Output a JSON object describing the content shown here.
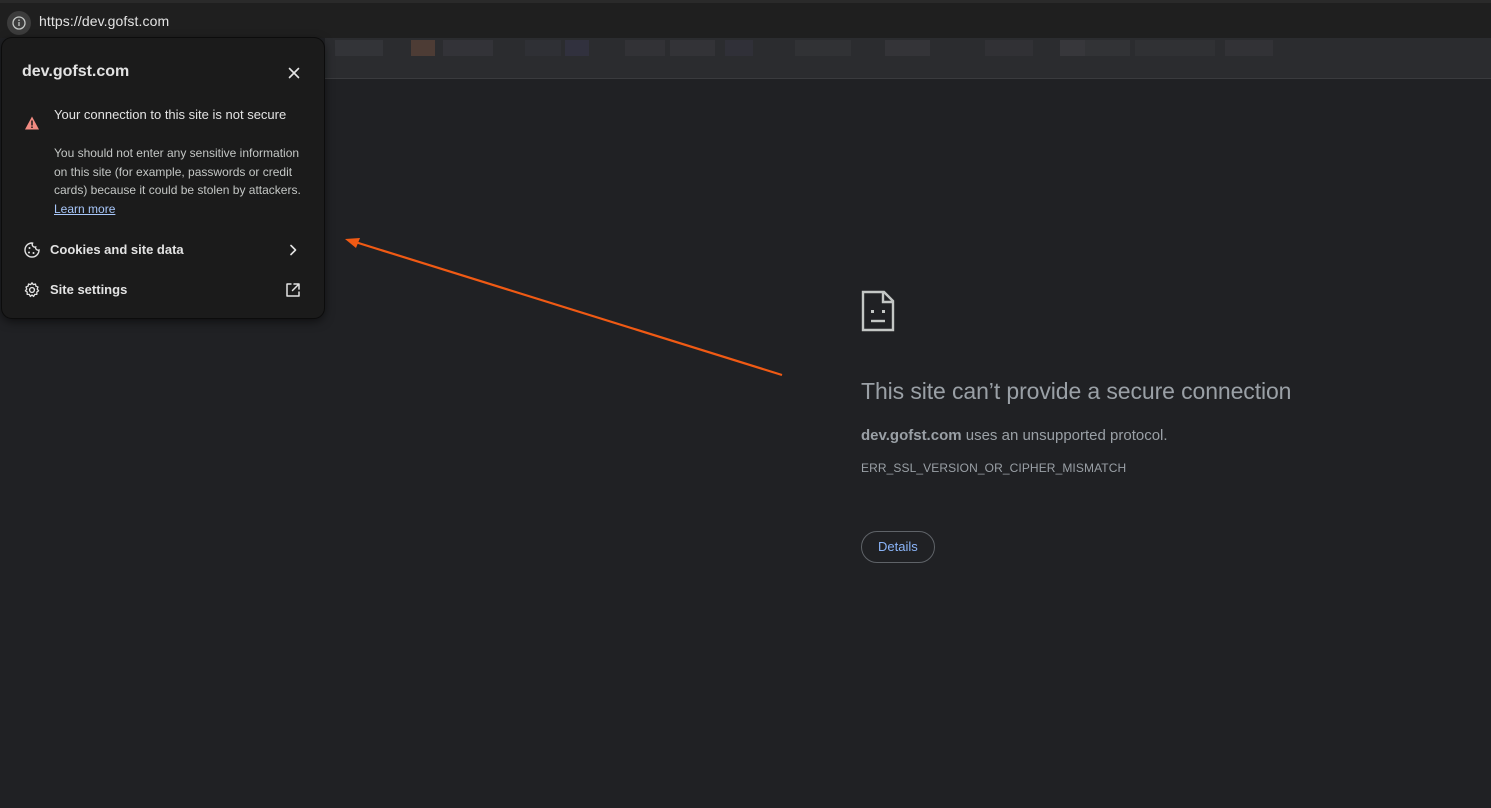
{
  "omnibox": {
    "url": "https://dev.gofst.com",
    "site_info_icon": "info-icon"
  },
  "popup": {
    "title": "dev.gofst.com",
    "close_icon": "close-icon",
    "security": {
      "icon": "warning-triangle-icon",
      "heading": "Your connection to this site is not secure",
      "body": "You should not enter any sensitive information on this site (for example, passwords or credit cards) because it could be stolen by attackers.",
      "learn_more": "Learn more"
    },
    "rows": [
      {
        "label": "Cookies and site data",
        "icon": "cookie-icon",
        "trail_icon": "chevron-right-icon"
      },
      {
        "label": "Site settings",
        "icon": "gear-icon",
        "trail_icon": "external-link-icon"
      }
    ]
  },
  "error_page": {
    "icon": "sad-document-icon",
    "title": "This site can’t provide a secure connection",
    "domain": "dev.gofst.com",
    "description_suffix": " uses an unsupported protocol.",
    "error_code": "ERR_SSL_VERSION_OR_CIPHER_MISMATCH",
    "details_label": "Details"
  },
  "annotation": {
    "arrow_color": "#f05a14"
  },
  "colors": {
    "page_bg": "#202124",
    "popup_bg": "#1b1b1b",
    "link": "#8ab4f8",
    "warning": "#f28b82"
  }
}
